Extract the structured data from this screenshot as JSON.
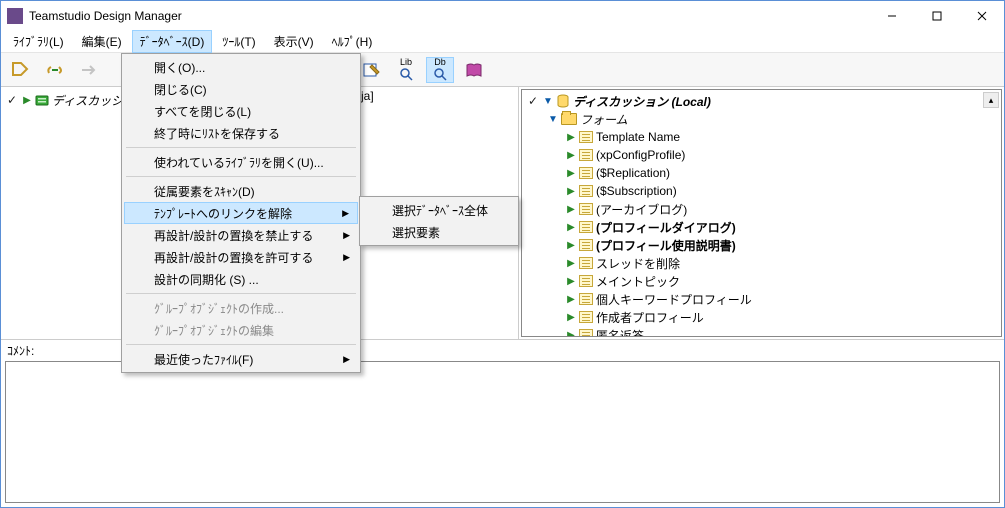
{
  "window": {
    "title": "Teamstudio Design Manager"
  },
  "menubar": {
    "library": "ﾗｲﾌﾞﾗﾘ(L)",
    "edit": "編集(E)",
    "database": "ﾃﾞｰﾀﾍﾞｰｽ(D)",
    "tool": "ﾂｰﾙ(T)",
    "view": "表示(V)",
    "help": "ﾍﾙﾌﾟ(H)"
  },
  "toolbar": {
    "lib_label": "Lib",
    "db_label": "Db"
  },
  "dropdown": {
    "open": "開く(O)...",
    "close": "閉じる(C)",
    "close_all": "すべてを閉じる(L)",
    "save_list_on_exit": "終了時にﾘｽﾄを保存する",
    "open_used_library": "使われているﾗｲﾌﾞﾗﾘを開く(U)...",
    "scan_dependents": "従属要素をｽｷｬﾝ(D)",
    "unlink_template": "ﾃﾝﾌﾟﾚｰﾄへのリンクを解除",
    "forbid_redesign": "再設計/設計の置換を禁止する",
    "allow_redesign": "再設計/設計の置換を許可する",
    "sync_design": "設計の同期化 (S) ...",
    "create_group": "ｸﾞﾙｰﾌﾟｵﾌﾞｼﾞｪｸﾄの作成...",
    "edit_group": "ｸﾞﾙｰﾌﾟｵﾌﾞｼﾞｪｸﾄの編集",
    "recent_files": "最近使ったﾌｧｲﾙ(F)"
  },
  "submenu": {
    "select_entire_db": "選択ﾃﾞｰﾀﾍﾞｰｽ全体",
    "select_elements": "選択要素"
  },
  "left_tree": {
    "root": "ディスカッション",
    "hint_suffix": "ja]"
  },
  "right_tree": {
    "root": "ディスカッション (Local)",
    "form": "フォーム",
    "items": [
      {
        "label": "Template Name"
      },
      {
        "label": "(xpConfigProfile)"
      },
      {
        "label": "($Replication)"
      },
      {
        "label": "($Subscription)"
      },
      {
        "label": "(アーカイブログ)"
      },
      {
        "label": "(プロフィールダイアログ)",
        "bold": true
      },
      {
        "label": "(プロフィール使用説明書)",
        "bold": true
      },
      {
        "label": "スレッドを削除"
      },
      {
        "label": "メイントピック"
      },
      {
        "label": "個人キーワードプロフィール"
      },
      {
        "label": "作成者プロフィール"
      },
      {
        "label": "匿名返答"
      }
    ]
  },
  "footer": {
    "label": "ｺﾒﾝﾄ:"
  },
  "icons": {
    "min": "–",
    "max": "□",
    "close": "✕"
  }
}
